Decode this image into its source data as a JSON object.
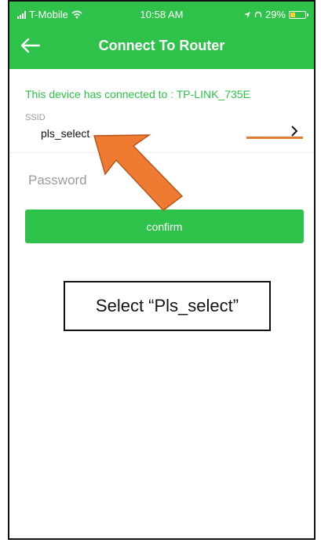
{
  "status_bar": {
    "carrier": "T-Mobile",
    "time": "10:58 AM",
    "battery": "29%"
  },
  "header": {
    "title": "Connect To Router"
  },
  "connection": {
    "message": "This device has connected to : TP-LINK_735E"
  },
  "ssid": {
    "label": "SSID",
    "value": "pls_select"
  },
  "password": {
    "placeholder": "Password"
  },
  "confirm_button": {
    "label": "confirm"
  },
  "annotation": {
    "text": "Select “Pls_select”"
  },
  "colors": {
    "accent": "#2fc24a",
    "arrow": "#ee7b31",
    "status_line": "#e07a35"
  },
  "icons": [
    "signal-icon",
    "wifi-icon",
    "location-icon",
    "headphones-icon",
    "battery-icon",
    "back-arrow-icon",
    "chevron-right-icon",
    "pointer-arrow"
  ]
}
